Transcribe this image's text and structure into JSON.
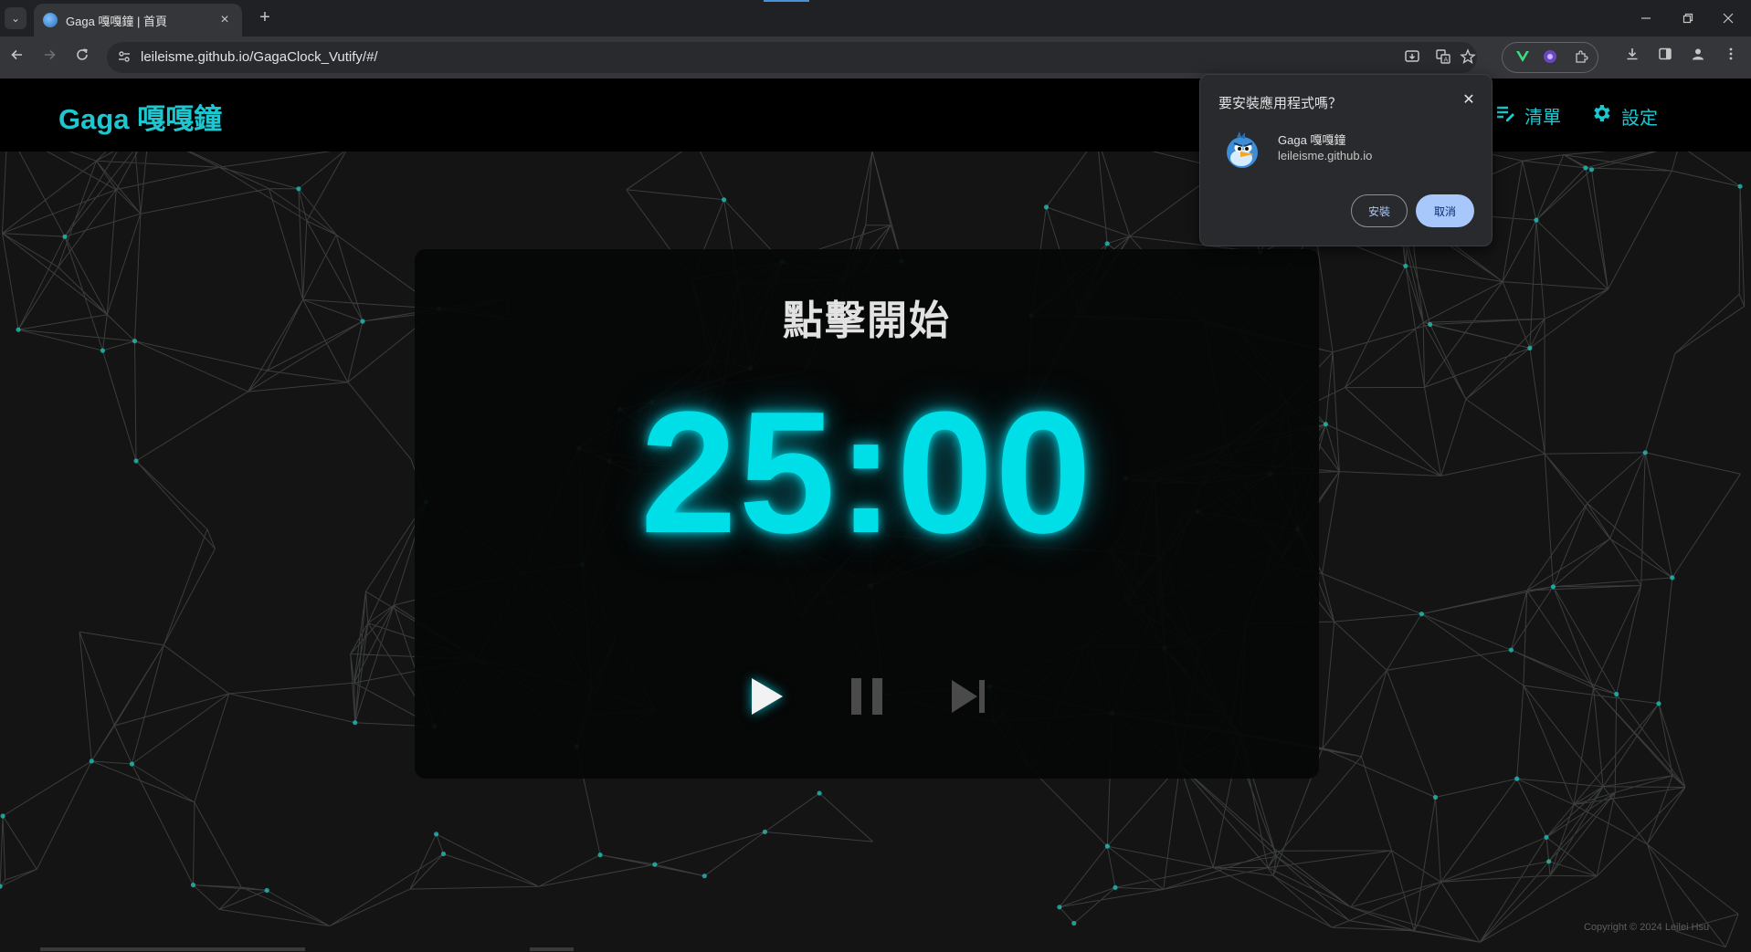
{
  "browser": {
    "tab_title": "Gaga 嘎嘎鐘 | 首頁",
    "url": "leileisme.github.io/GagaClock_Vutify/#/"
  },
  "app": {
    "brand": "Gaga 嘎嘎鐘",
    "nav": {
      "list_label": "清單",
      "settings_label": "設定"
    }
  },
  "timer": {
    "status": "點擊開始",
    "time": "25:00"
  },
  "footer": {
    "copyright": "Copyright © 2024 Leilei Hsu"
  },
  "install_prompt": {
    "title": "要安裝應用程式嗎？",
    "app_name": "Gaga 嘎嘎鐘",
    "app_domain": "leileisme.github.io",
    "install_label": "安裝",
    "cancel_label": "取消"
  },
  "colors": {
    "accent": "#1cc7d0",
    "timer": "#00dfe8",
    "background": "#141414"
  }
}
